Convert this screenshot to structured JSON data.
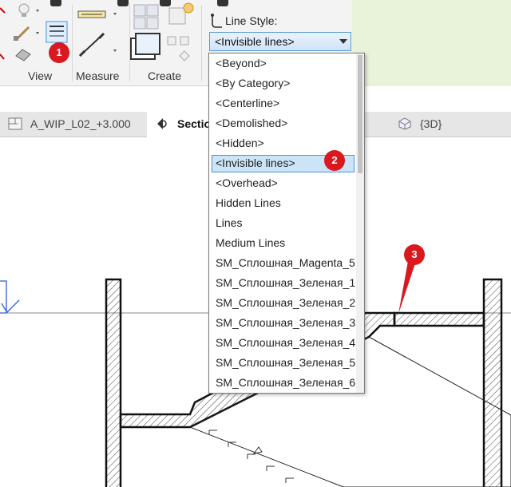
{
  "ribbon": {
    "panels": [
      {
        "label": "View"
      },
      {
        "label": "Measure"
      },
      {
        "label": "Create"
      }
    ],
    "line_style_label": "Line Style:",
    "line_style_value": "<Invisible lines>"
  },
  "tabs": [
    {
      "label": "A_WIP_L02_+3.000",
      "icon": "floor-plan-icon"
    },
    {
      "label": "Section",
      "icon": "section-view-icon",
      "active": true
    },
    {
      "label": "{3D}",
      "icon": "3d-cube-icon"
    }
  ],
  "dropdown": {
    "options": [
      "<Beyond>",
      "<By Category>",
      "<Centerline>",
      "<Demolished>",
      "<Hidden>",
      "<Invisible lines>",
      "<Overhead>",
      "Hidden Lines",
      "Lines",
      "Medium Lines",
      "SM_Сплошная_Magenta_5",
      "SM_Сплошная_Зеленая_1",
      "SM_Сплошная_Зеленая_2",
      "SM_Сплошная_Зеленая_3",
      "SM_Сплошная_Зеленая_4",
      "SM_Сплошная_Зеленая_5",
      "SM_Сплошная_Зеленая_6"
    ],
    "selected": "<Invisible lines>"
  },
  "callouts": [
    "1",
    "2",
    "3"
  ],
  "colors": {
    "callout": "#d9181f",
    "selection": "#cce4f7",
    "selection_border": "#4a90d9",
    "ribbon_green": "#e8f3da"
  }
}
